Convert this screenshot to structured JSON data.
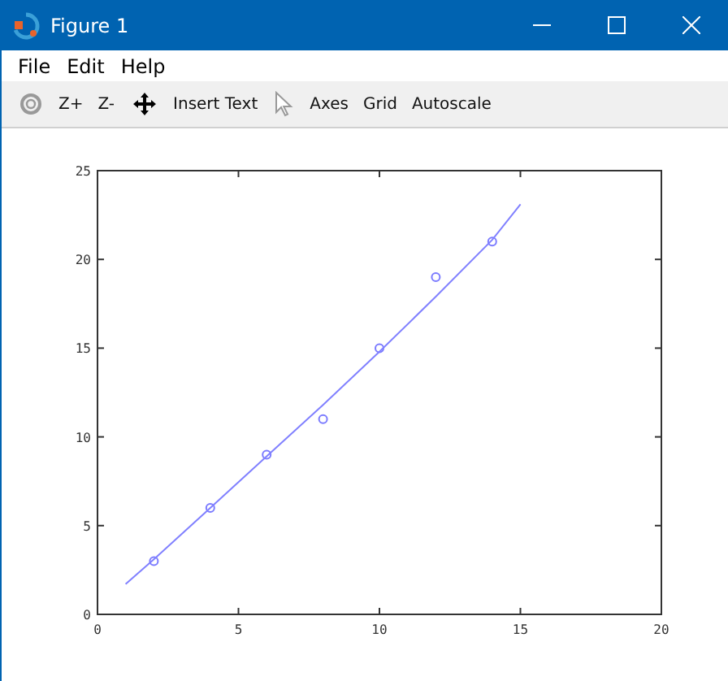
{
  "window": {
    "title": "Figure 1"
  },
  "menu": [
    "File",
    "Edit",
    "Help"
  ],
  "toolbar": [
    {
      "kind": "rotate",
      "disabled": true
    },
    {
      "kind": "text",
      "label": "Z+"
    },
    {
      "kind": "text",
      "label": "Z-"
    },
    {
      "kind": "pan",
      "disabled": false
    },
    {
      "kind": "text",
      "label": "Insert Text"
    },
    {
      "kind": "pointer",
      "disabled": true
    },
    {
      "kind": "text",
      "label": "Axes"
    },
    {
      "kind": "text",
      "label": "Grid"
    },
    {
      "kind": "text",
      "label": "Autoscale"
    }
  ],
  "plot": {
    "chart_data": {
      "type": "scatter",
      "x": [
        1,
        2,
        4,
        6,
        8,
        10,
        12,
        14,
        15
      ],
      "series": [
        {
          "color": "#7b7bff",
          "values": [
            null,
            3,
            6,
            9,
            11,
            15,
            19,
            21,
            null
          ]
        },
        {
          "type": "line",
          "color": "#8080ff",
          "values": [
            1.7,
            3.1,
            6.0,
            8.9,
            11.8,
            14.8,
            17.9,
            21.1,
            23.1
          ]
        }
      ],
      "xlim": [
        0,
        20
      ],
      "ylim": [
        0,
        25
      ],
      "xticks": [
        0,
        5,
        10,
        15,
        20
      ],
      "yticks": [
        0,
        5,
        10,
        15,
        20,
        25
      ]
    }
  }
}
